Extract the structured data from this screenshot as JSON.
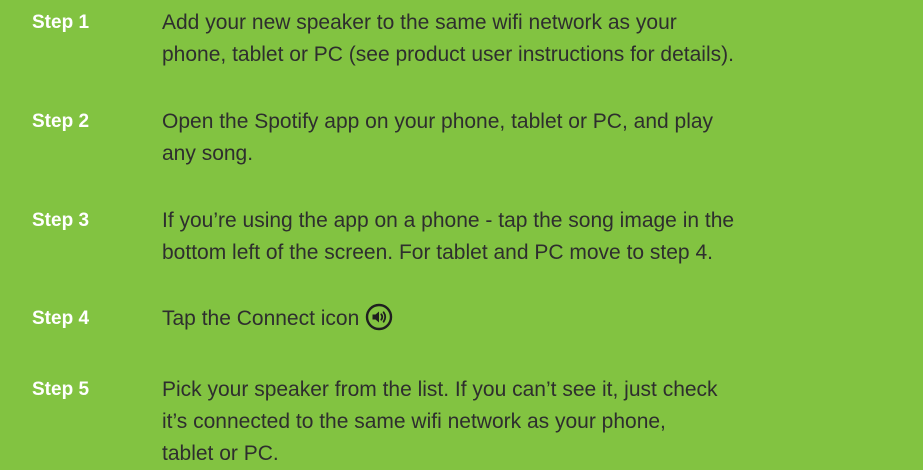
{
  "steps": [
    {
      "label": "Step 1",
      "lines": [
        "Add your new speaker to the same wifi network as your",
        "phone, tablet or PC (see product user instructions for details)."
      ]
    },
    {
      "label": "Step 2",
      "lines": [
        "Open the Spotify app on your phone, tablet or PC, and play",
        "any song."
      ]
    },
    {
      "label": "Step 3",
      "lines": [
        "If you’re using the app on a phone - tap the song image in the",
        "bottom left of the screen. For tablet and PC move to step 4."
      ]
    },
    {
      "label": "Step 4",
      "lines": [
        "Tap the Connect icon"
      ],
      "icon": "speaker-connect-icon"
    },
    {
      "label": "Step 5",
      "lines": [
        "Pick your speaker from the list. If you can’t see it, just check",
        "it’s connected to the same wifi network as your phone,",
        "tablet or PC."
      ]
    }
  ],
  "colors": {
    "background": "#82c341",
    "label": "#ffffff",
    "text": "#2e2e2e"
  }
}
